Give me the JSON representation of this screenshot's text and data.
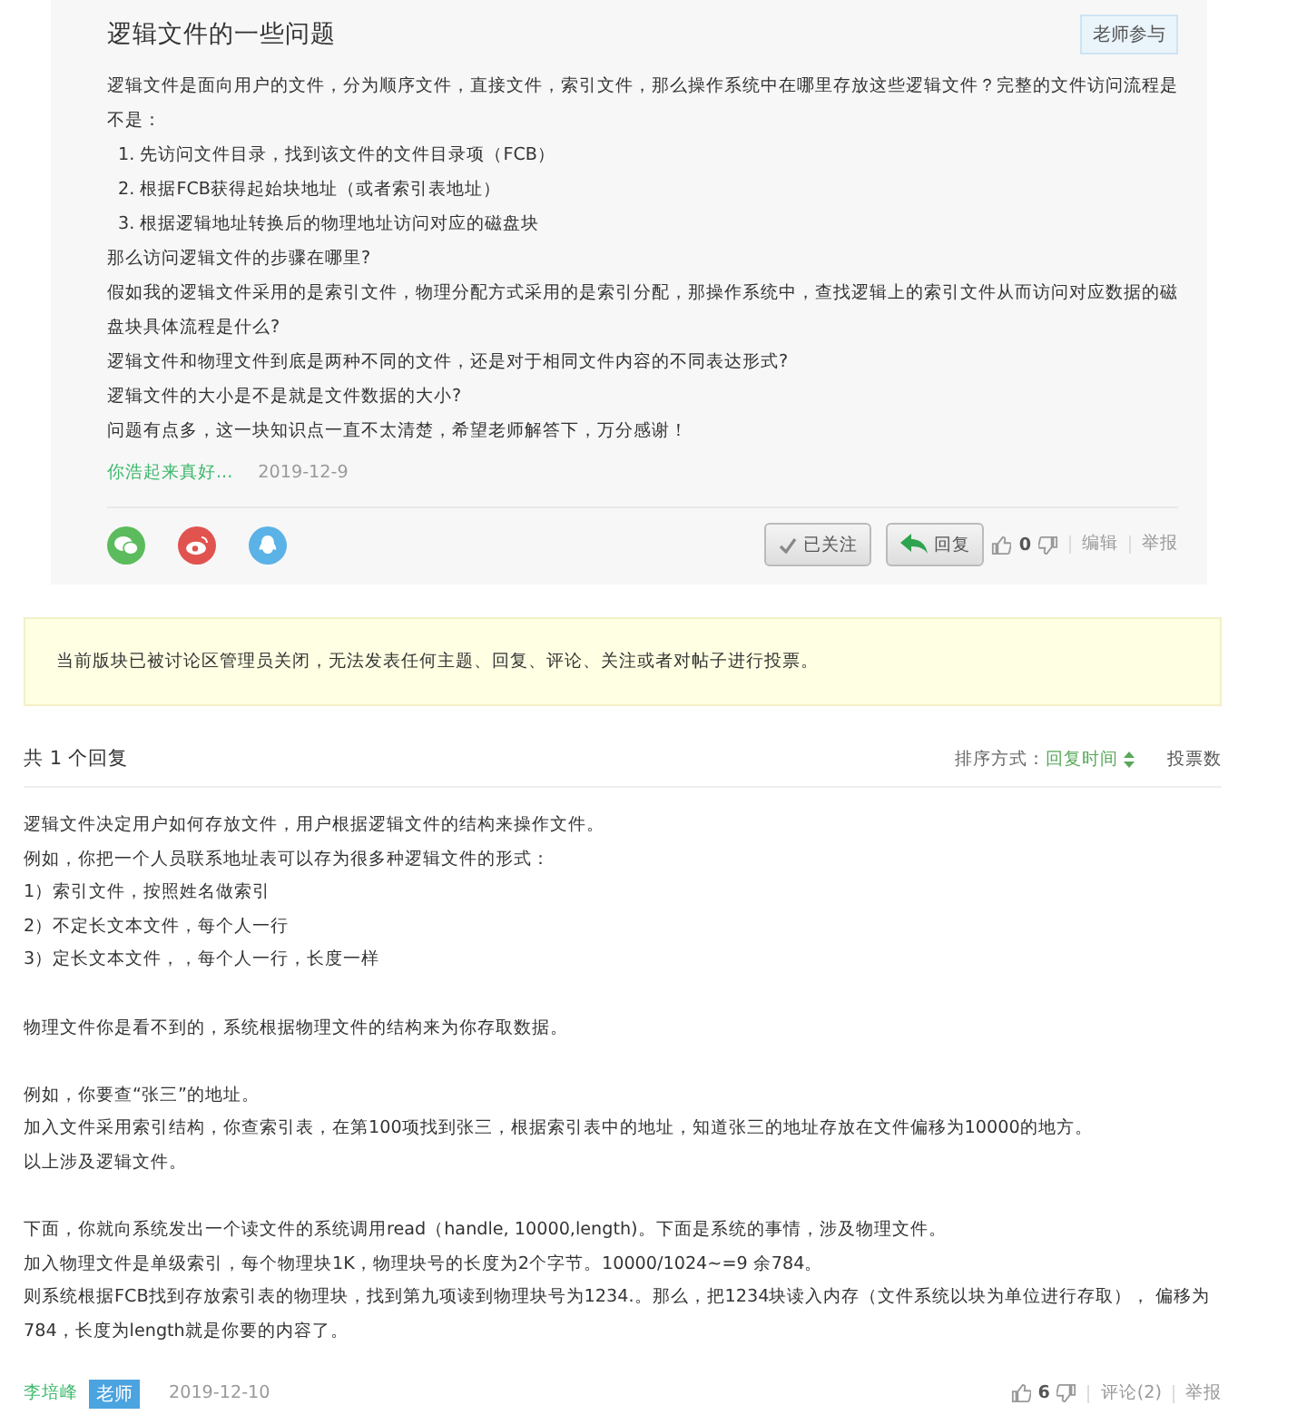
{
  "question": {
    "title": "逻辑文件的一些问题",
    "badge": "老师参与",
    "paragraphs": [
      {
        "kind": "text",
        "text": "逻辑文件是面向用户的文件，分为顺序文件，直接文件，索引文件，那么操作系统中在哪里存放这些逻辑文件？完整的文件访问流程是不是："
      },
      {
        "kind": "item",
        "text": "1. 先访问文件目录，找到该文件的文件目录项（FCB）"
      },
      {
        "kind": "item",
        "text": "2. 根据FCB获得起始块地址（或者索引表地址）"
      },
      {
        "kind": "item",
        "text": "3. 根据逻辑地址转换后的物理地址访问对应的磁盘块"
      },
      {
        "kind": "text",
        "text": "那么访问逻辑文件的步骤在哪里?"
      },
      {
        "kind": "text",
        "text": "假如我的逻辑文件采用的是索引文件，物理分配方式采用的是索引分配，那操作系统中，查找逻辑上的索引文件从而访问对应数据的磁盘块具体流程是什么?"
      },
      {
        "kind": "text",
        "text": "逻辑文件和物理文件到底是两种不同的文件，还是对于相同文件内容的不同表达形式?"
      },
      {
        "kind": "text",
        "text": "逻辑文件的大小是不是就是文件数据的大小?"
      },
      {
        "kind": "text",
        "text": "问题有点多，这一块知识点一直不太清楚，希望老师解答下，万分感谢！"
      }
    ],
    "author": "你浩起来真好...",
    "date": "2019-12-9",
    "follow_button": "已关注",
    "reply_button": "回复",
    "votes": "0",
    "links": [
      "编辑",
      "举报"
    ]
  },
  "notice": "当前版块已被讨论区管理员关闭，无法发表任何主题、回复、评论、关注或者对帖子进行投票。",
  "replies_header": {
    "count": "共 1 个回复",
    "sort_label": "排序方式：",
    "sort_options": [
      {
        "label": "回复时间",
        "selected": true
      },
      {
        "label": "投票数",
        "selected": false
      }
    ]
  },
  "reply": {
    "blocks": [
      [
        "逻辑文件决定用户如何存放文件，用户根据逻辑文件的结构来操作文件。",
        "例如，你把一个人员联系地址表可以存为很多种逻辑文件的形式：",
        "1）索引文件，按照姓名做索引",
        "2）不定长文本文件，每个人一行",
        "3）定长文本文件，，每个人一行，长度一样"
      ],
      [
        "物理文件你是看不到的，系统根据物理文件的结构来为你存取数据。"
      ],
      [
        "例如，你要查“张三”的地址。",
        "加入文件采用索引结构，你查索引表，在第100项找到张三，根据索引表中的地址，知道张三的地址存放在文件偏移为10000的地方。",
        "以上涉及逻辑文件。"
      ],
      [
        "下面，你就向系统发出一个读文件的系统调用read（handle, 10000,length)。下面是系统的事情，涉及物理文件。",
        "加入物理文件是单级索引，每个物理块1K，物理块号的长度为2个字节。10000/1024~=9 余784。",
        "则系统根据FCB找到存放索引表的物理块，找到第九项读到物理块号为1234.。那么，把1234块读入内存（文件系统以块为单位进行存取），  偏移为784，长度为length就是你要的内容了。"
      ]
    ],
    "author": "李培峰",
    "role": "老师",
    "date": "2019-12-10",
    "votes": "6",
    "links": [
      "评论(2)",
      "举报"
    ]
  }
}
